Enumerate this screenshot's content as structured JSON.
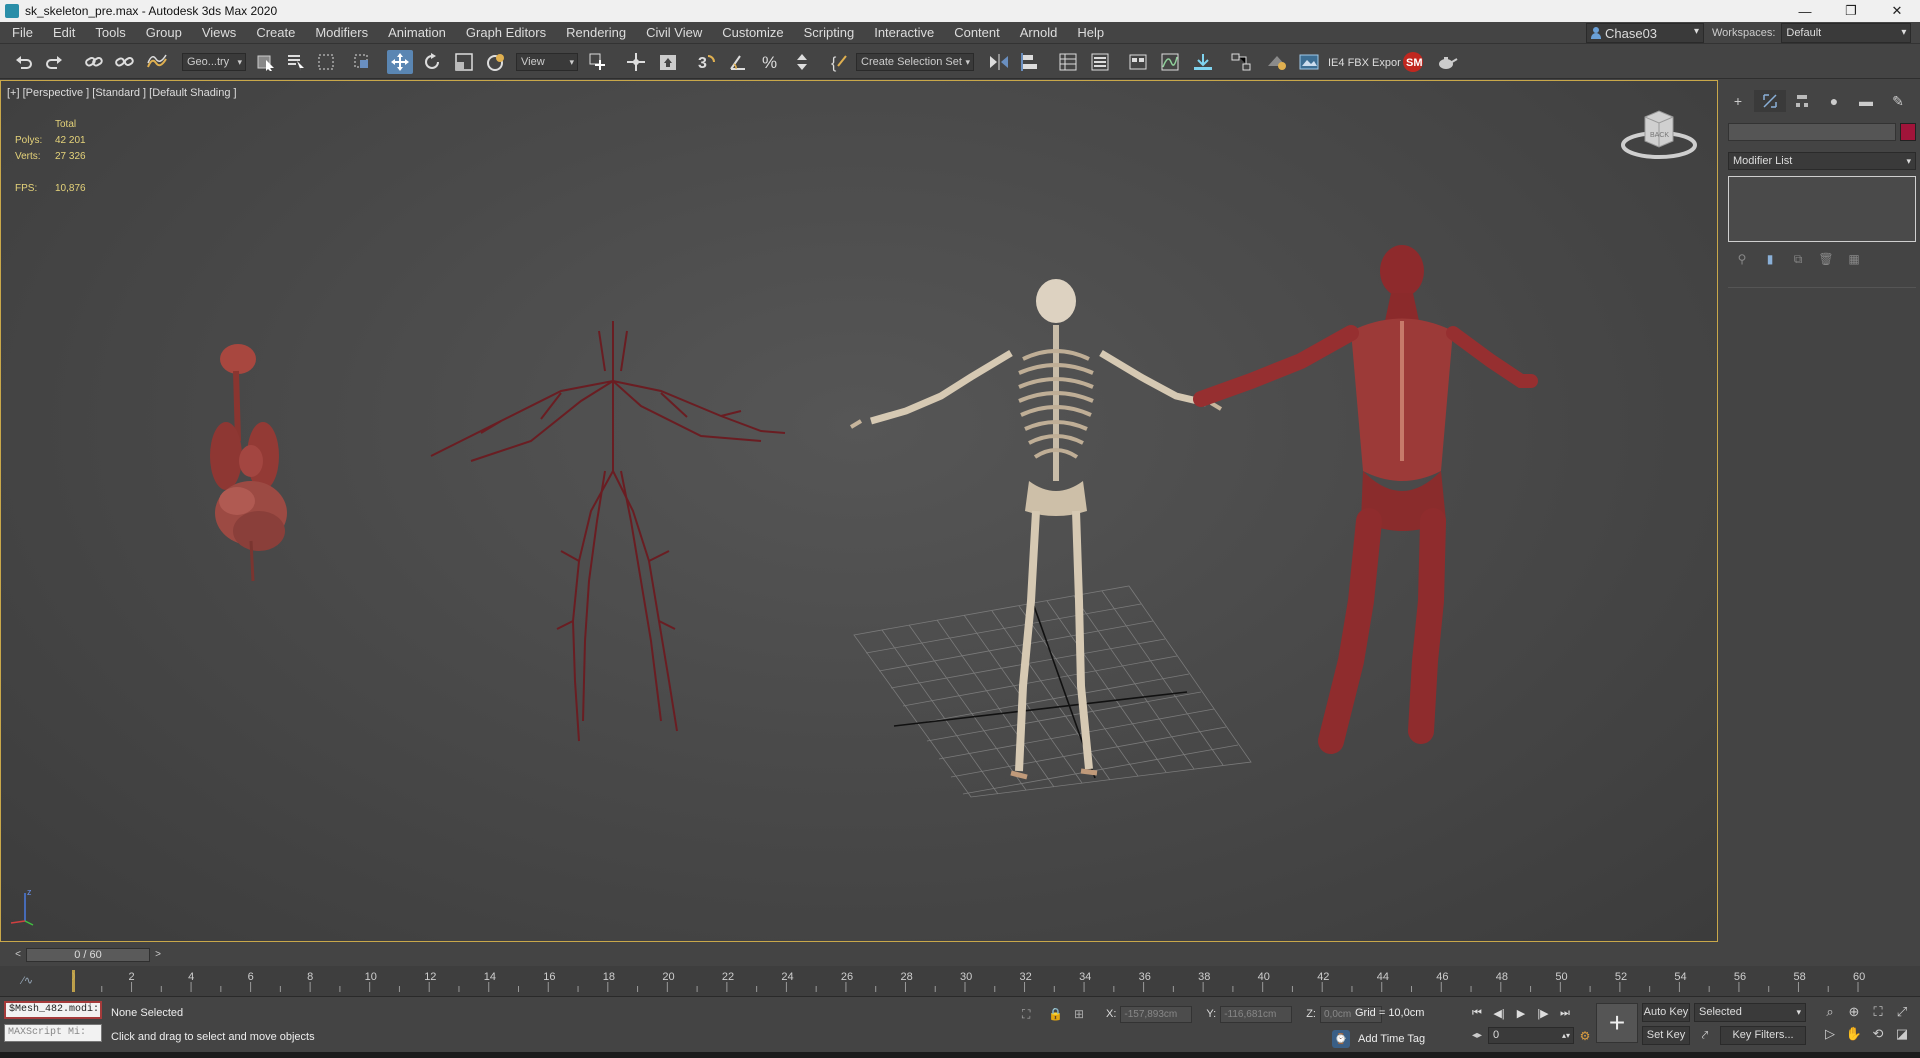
{
  "window": {
    "title": "sk_skeleton_pre.max - Autodesk 3ds Max 2020",
    "minimize": "—",
    "restore": "❐",
    "close": "✕"
  },
  "menu": [
    "File",
    "Edit",
    "Tools",
    "Group",
    "Views",
    "Create",
    "Modifiers",
    "Animation",
    "Graph Editors",
    "Rendering",
    "Civil View",
    "Customize",
    "Scripting",
    "Interactive",
    "Content",
    "Arnold",
    "Help"
  ],
  "user": {
    "name": "Chase03"
  },
  "workspaces": {
    "label": "Workspaces:",
    "value": "Default"
  },
  "toolbar": {
    "selection_filter": "Geo...try",
    "ref_coord": "View",
    "named_selection": "Create Selection Set",
    "fbx_label": "IE4 FBX Expor"
  },
  "viewport": {
    "label": "[+] [Perspective ] [Standard ] [Default Shading ]",
    "stats": {
      "header": "Total",
      "polys_label": "Polys:",
      "polys": "42 201",
      "verts_label": "Verts:",
      "verts": "27 326",
      "fps_label": "FPS:",
      "fps": "10,876"
    },
    "viewcube_face": "BACK",
    "axis_label": "z"
  },
  "command_panel": {
    "modifier_list": "Modifier List",
    "object_color": "#a1143a"
  },
  "time_slider": {
    "value": "0 / 60",
    "current": 0,
    "end": 60
  },
  "ruler": {
    "ticks": [
      0,
      2,
      4,
      6,
      8,
      10,
      12,
      14,
      16,
      18,
      20,
      22,
      24,
      26,
      28,
      30,
      32,
      34,
      36,
      38,
      40,
      42,
      44,
      46,
      48,
      50,
      52,
      54,
      56,
      58,
      60
    ]
  },
  "status": {
    "maxscript_1": "$Mesh_482.modi:",
    "maxscript_2": "MAXScript Mi:",
    "selection": "None Selected",
    "prompt": "Click and drag to select and move objects",
    "x_label": "X:",
    "x": "-157,893cm",
    "y_label": "Y:",
    "y": "-116,681cm",
    "z_label": "Z:",
    "z": "0,0cm",
    "grid": "Grid = 10,0cm",
    "add_time_tag": "Add Time Tag",
    "frame": "0",
    "auto_key": "Auto Key",
    "set_key": "Set Key",
    "selected": "Selected",
    "key_filters": "Key Filters..."
  }
}
